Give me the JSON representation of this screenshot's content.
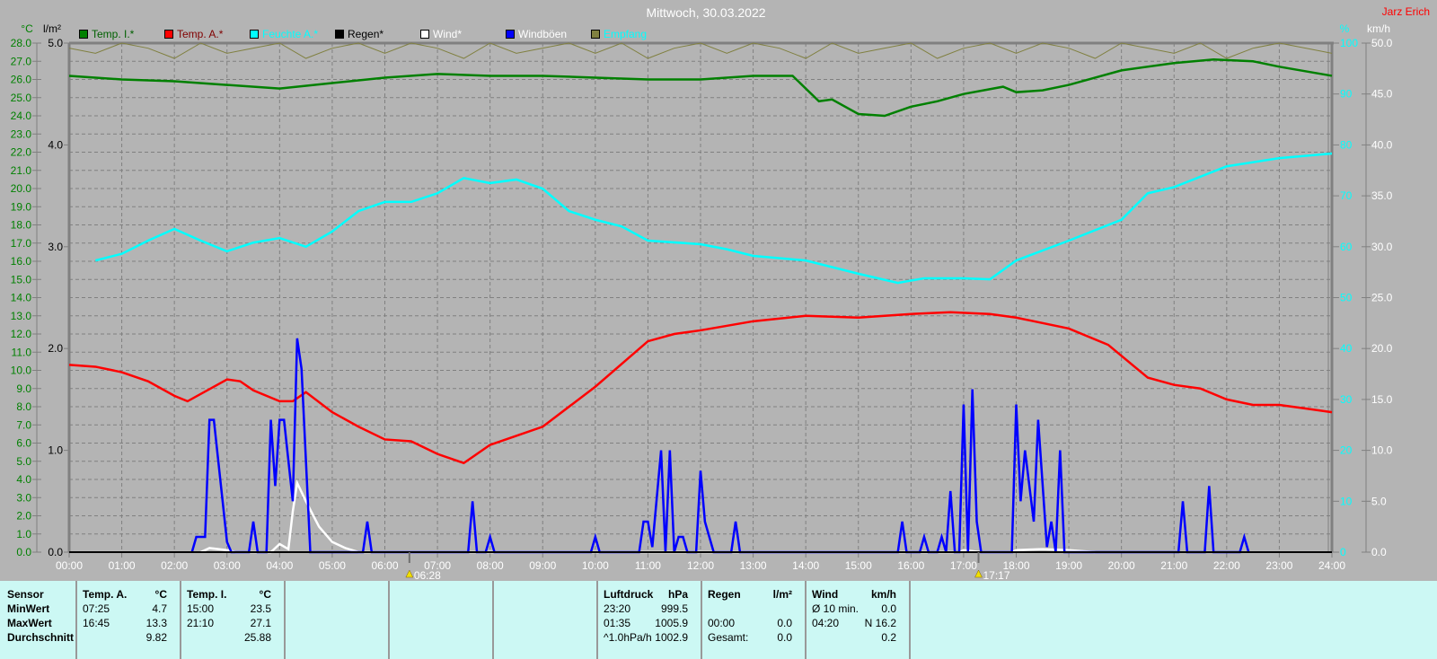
{
  "header": {
    "title": "Mittwoch, 30.03.2022",
    "author": "Jarz Erich"
  },
  "legend": [
    {
      "label": "Temp. I.*",
      "color": "#008000",
      "text_color": "#006000"
    },
    {
      "label": "Temp. A.*",
      "color": "#ff0000",
      "text_color": "#800000"
    },
    {
      "label": "Feuchte A.*",
      "color": "#00ffff",
      "text_color": "#00ffff"
    },
    {
      "label": "Regen*",
      "color": "#000000",
      "text_color": "#000000"
    },
    {
      "label": "Wind*",
      "color": "#ffffff",
      "text_color": "#ffffff"
    },
    {
      "label": "Windböen",
      "color": "#0000ff",
      "text_color": "#ffffff"
    },
    {
      "label": "Empfang",
      "color": "#808040",
      "text_color": "#00ffff"
    }
  ],
  "chart_data": {
    "type": "line",
    "title": "Mittwoch, 30.03.2022",
    "xlabel": "",
    "x_ticks": [
      "00:00",
      "01:00",
      "02:00",
      "03:00",
      "04:00",
      "05:00",
      "06:00",
      "07:00",
      "08:00",
      "09:00",
      "10:00",
      "11:00",
      "12:00",
      "13:00",
      "14:00",
      "15:00",
      "16:00",
      "17:00",
      "18:00",
      "19:00",
      "20:00",
      "21:00",
      "22:00",
      "23:00",
      "24:00"
    ],
    "axes": {
      "temp": {
        "unit": "°C",
        "range": [
          0,
          28
        ],
        "step": 1,
        "color": "#008000"
      },
      "rain": {
        "unit": "l/m²",
        "range": [
          0,
          5
        ],
        "step": 1,
        "color": "#000000"
      },
      "humidity": {
        "unit": "%",
        "range": [
          0,
          100
        ],
        "step": 10,
        "color": "#00ffff"
      },
      "wind": {
        "unit": "km/h",
        "range": [
          0,
          50
        ],
        "step": 5,
        "color": "#ffffff"
      }
    },
    "grid": true,
    "sunrise": "06:28",
    "sunset": "17:17",
    "series": [
      {
        "name": "Temp. I.",
        "axis": "temp",
        "color": "#008000",
        "points": [
          [
            "00:00",
            26.2
          ],
          [
            "01:00",
            26.0
          ],
          [
            "02:00",
            25.9
          ],
          [
            "03:00",
            25.7
          ],
          [
            "04:00",
            25.5
          ],
          [
            "05:00",
            25.8
          ],
          [
            "06:00",
            26.1
          ],
          [
            "07:00",
            26.3
          ],
          [
            "08:00",
            26.2
          ],
          [
            "09:00",
            26.2
          ],
          [
            "10:00",
            26.1
          ],
          [
            "11:00",
            26.0
          ],
          [
            "12:00",
            26.0
          ],
          [
            "13:00",
            26.2
          ],
          [
            "13:45",
            26.2
          ],
          [
            "14:15",
            24.8
          ],
          [
            "14:30",
            24.9
          ],
          [
            "15:00",
            24.1
          ],
          [
            "15:30",
            24.0
          ],
          [
            "16:00",
            24.5
          ],
          [
            "16:30",
            24.8
          ],
          [
            "17:00",
            25.2
          ],
          [
            "17:45",
            25.6
          ],
          [
            "18:00",
            25.3
          ],
          [
            "18:30",
            25.4
          ],
          [
            "19:00",
            25.7
          ],
          [
            "20:00",
            26.5
          ],
          [
            "21:00",
            26.9
          ],
          [
            "21:45",
            27.1
          ],
          [
            "22:30",
            27.0
          ],
          [
            "23:00",
            26.7
          ],
          [
            "24:00",
            26.2
          ]
        ]
      },
      {
        "name": "Temp. A.",
        "axis": "temp",
        "color": "#ff0000",
        "points": [
          [
            "00:00",
            10.3
          ],
          [
            "00:30",
            10.2
          ],
          [
            "01:00",
            9.9
          ],
          [
            "01:30",
            9.4
          ],
          [
            "02:00",
            8.6
          ],
          [
            "02:15",
            8.3
          ],
          [
            "02:30",
            8.7
          ],
          [
            "03:00",
            9.5
          ],
          [
            "03:15",
            9.4
          ],
          [
            "03:30",
            8.9
          ],
          [
            "04:00",
            8.3
          ],
          [
            "04:15",
            8.3
          ],
          [
            "04:30",
            8.8
          ],
          [
            "05:00",
            7.7
          ],
          [
            "05:30",
            6.9
          ],
          [
            "06:00",
            6.2
          ],
          [
            "06:30",
            6.1
          ],
          [
            "07:00",
            5.4
          ],
          [
            "07:30",
            4.9
          ],
          [
            "08:00",
            5.9
          ],
          [
            "09:00",
            6.9
          ],
          [
            "10:00",
            9.1
          ],
          [
            "11:00",
            11.6
          ],
          [
            "11:30",
            12.0
          ],
          [
            "12:00",
            12.2
          ],
          [
            "13:00",
            12.7
          ],
          [
            "14:00",
            13.0
          ],
          [
            "15:00",
            12.9
          ],
          [
            "16:00",
            13.1
          ],
          [
            "16:45",
            13.2
          ],
          [
            "17:30",
            13.1
          ],
          [
            "18:00",
            12.9
          ],
          [
            "19:00",
            12.3
          ],
          [
            "19:45",
            11.4
          ],
          [
            "20:30",
            9.6
          ],
          [
            "21:00",
            9.2
          ],
          [
            "21:30",
            9.0
          ],
          [
            "22:00",
            8.4
          ],
          [
            "22:30",
            8.1
          ],
          [
            "23:00",
            8.1
          ],
          [
            "23:30",
            7.9
          ],
          [
            "24:00",
            7.7
          ]
        ]
      },
      {
        "name": "Feuchte A.",
        "axis": "humidity",
        "color": "#00ffff",
        "points": [
          [
            "00:30",
            57.3
          ],
          [
            "01:00",
            58.6
          ],
          [
            "01:30",
            61.2
          ],
          [
            "02:00",
            63.5
          ],
          [
            "02:30",
            61.2
          ],
          [
            "03:00",
            59.1
          ],
          [
            "03:30",
            60.8
          ],
          [
            "04:00",
            61.7
          ],
          [
            "04:30",
            60.0
          ],
          [
            "05:00",
            63.0
          ],
          [
            "05:30",
            67.0
          ],
          [
            "06:00",
            68.8
          ],
          [
            "06:30",
            68.8
          ],
          [
            "07:00",
            70.5
          ],
          [
            "07:30",
            73.5
          ],
          [
            "08:00",
            72.5
          ],
          [
            "08:30",
            73.2
          ],
          [
            "09:00",
            71.4
          ],
          [
            "09:30",
            67.0
          ],
          [
            "10:00",
            65.3
          ],
          [
            "10:30",
            64.0
          ],
          [
            "11:00",
            61.2
          ],
          [
            "12:00",
            60.5
          ],
          [
            "12:30",
            59.5
          ],
          [
            "13:00",
            58.2
          ],
          [
            "14:00",
            57.3
          ],
          [
            "15:00",
            54.7
          ],
          [
            "15:45",
            52.9
          ],
          [
            "16:15",
            53.8
          ],
          [
            "17:00",
            53.8
          ],
          [
            "17:30",
            53.6
          ],
          [
            "18:00",
            57.3
          ],
          [
            "19:00",
            61.2
          ],
          [
            "20:00",
            65.3
          ],
          [
            "20:30",
            70.5
          ],
          [
            "21:00",
            71.7
          ],
          [
            "22:00",
            75.8
          ],
          [
            "23:00",
            77.4
          ],
          [
            "24:00",
            78.3
          ]
        ]
      },
      {
        "name": "Wind",
        "axis": "wind",
        "color": "#ffffff",
        "points": [
          [
            "02:30",
            0
          ],
          [
            "02:40",
            0.4
          ],
          [
            "03:00",
            0.2
          ],
          [
            "03:10",
            0
          ],
          [
            "03:50",
            0
          ],
          [
            "04:00",
            0.8
          ],
          [
            "04:10",
            0.3
          ],
          [
            "04:15",
            4
          ],
          [
            "04:20",
            6.8
          ],
          [
            "04:30",
            5
          ],
          [
            "04:45",
            2.5
          ],
          [
            "05:00",
            1
          ],
          [
            "05:15",
            0.4
          ],
          [
            "05:30",
            0
          ],
          [
            "16:55",
            0
          ],
          [
            "17:00",
            0.2
          ],
          [
            "17:20",
            0
          ],
          [
            "17:55",
            0
          ],
          [
            "18:00",
            0.2
          ],
          [
            "18:30",
            0.3
          ],
          [
            "19:00",
            0.2
          ],
          [
            "19:30",
            0
          ]
        ]
      },
      {
        "name": "Windböen",
        "axis": "wind",
        "color": "#0000ff",
        "points": [
          [
            "02:20",
            0
          ],
          [
            "02:25",
            1.5
          ],
          [
            "02:35",
            1.5
          ],
          [
            "02:40",
            13
          ],
          [
            "02:45",
            13
          ],
          [
            "02:55",
            5
          ],
          [
            "03:00",
            1
          ],
          [
            "03:05",
            0
          ],
          [
            "03:25",
            0
          ],
          [
            "03:30",
            3
          ],
          [
            "03:35",
            0
          ],
          [
            "03:45",
            0
          ],
          [
            "03:50",
            13
          ],
          [
            "03:55",
            6.5
          ],
          [
            "04:00",
            13
          ],
          [
            "04:05",
            13
          ],
          [
            "04:15",
            5
          ],
          [
            "04:20",
            21
          ],
          [
            "04:25",
            18
          ],
          [
            "04:35",
            0
          ],
          [
            "05:35",
            0
          ],
          [
            "05:40",
            3
          ],
          [
            "05:45",
            0
          ],
          [
            "07:35",
            0
          ],
          [
            "07:40",
            5
          ],
          [
            "07:45",
            0
          ],
          [
            "07:55",
            0
          ],
          [
            "08:00",
            1.5
          ],
          [
            "08:05",
            0
          ],
          [
            "09:55",
            0
          ],
          [
            "10:00",
            1.5
          ],
          [
            "10:05",
            0
          ],
          [
            "10:50",
            0
          ],
          [
            "10:55",
            3
          ],
          [
            "11:00",
            3
          ],
          [
            "11:05",
            0.5
          ],
          [
            "11:15",
            10
          ],
          [
            "11:20",
            0
          ],
          [
            "11:25",
            10
          ],
          [
            "11:30",
            0
          ],
          [
            "11:35",
            1.5
          ],
          [
            "11:40",
            1.5
          ],
          [
            "11:45",
            0
          ],
          [
            "11:55",
            0
          ],
          [
            "12:00",
            8
          ],
          [
            "12:05",
            3
          ],
          [
            "12:15",
            0
          ],
          [
            "12:35",
            0
          ],
          [
            "12:40",
            3
          ],
          [
            "12:45",
            0
          ],
          [
            "15:45",
            0
          ],
          [
            "15:50",
            3
          ],
          [
            "15:55",
            0
          ],
          [
            "16:10",
            0
          ],
          [
            "16:15",
            1.5
          ],
          [
            "16:20",
            0
          ],
          [
            "16:30",
            0
          ],
          [
            "16:35",
            1.5
          ],
          [
            "16:40",
            0
          ],
          [
            "16:45",
            6
          ],
          [
            "16:50",
            0
          ],
          [
            "16:55",
            0
          ],
          [
            "17:00",
            14.5
          ],
          [
            "17:05",
            0
          ],
          [
            "17:10",
            16
          ],
          [
            "17:15",
            3
          ],
          [
            "17:20",
            0
          ],
          [
            "17:55",
            0
          ],
          [
            "18:00",
            14.5
          ],
          [
            "18:05",
            5
          ],
          [
            "18:10",
            10
          ],
          [
            "18:20",
            3
          ],
          [
            "18:25",
            13
          ],
          [
            "18:35",
            0.5
          ],
          [
            "18:40",
            3
          ],
          [
            "18:45",
            0
          ],
          [
            "18:50",
            10
          ],
          [
            "18:55",
            0
          ],
          [
            "21:05",
            0
          ],
          [
            "21:10",
            5
          ],
          [
            "21:15",
            0
          ],
          [
            "21:35",
            0
          ],
          [
            "21:40",
            6.5
          ],
          [
            "21:45",
            0
          ],
          [
            "22:15",
            0
          ],
          [
            "22:20",
            1.5
          ],
          [
            "22:25",
            0
          ]
        ]
      },
      {
        "name": "Empfang",
        "axis": "humidity",
        "color": "#808040",
        "step_minutes": 30,
        "values": [
          99,
          98,
          100,
          99,
          97,
          100,
          98,
          99,
          100,
          97,
          99,
          100,
          98,
          100,
          99,
          97,
          100,
          98,
          99,
          100,
          98,
          100,
          97,
          99,
          100,
          98,
          100,
          99,
          97,
          100,
          98,
          99,
          100,
          97,
          99,
          100,
          98,
          100,
          99,
          97,
          100,
          99,
          98,
          100,
          97,
          99,
          100,
          99,
          98
        ]
      },
      {
        "name": "Regen",
        "axis": "rain",
        "color": "#000000",
        "points": [
          [
            "00:00",
            0
          ],
          [
            "24:00",
            0
          ]
        ]
      }
    ]
  },
  "table": {
    "columns": [
      {
        "header": [
          "Sensor",
          ""
        ],
        "rows": [
          [
            "MinWert",
            ""
          ],
          [
            "MaxWert",
            ""
          ],
          [
            "Durchschnitt",
            ""
          ]
        ],
        "bold_rows": true
      },
      {
        "header": [
          "Temp. A.",
          "°C"
        ],
        "rows": [
          [
            "07:25",
            "4.7"
          ],
          [
            "16:45",
            "13.3"
          ],
          [
            "",
            "9.82"
          ]
        ]
      },
      {
        "header": [
          "Temp. I.",
          "°C"
        ],
        "rows": [
          [
            "15:00",
            "23.5"
          ],
          [
            "21:10",
            "27.1"
          ],
          [
            "",
            "25.88"
          ]
        ]
      },
      {
        "header": [
          "",
          ""
        ],
        "rows": []
      },
      {
        "header": [
          "",
          ""
        ],
        "rows": []
      },
      {
        "header": [
          "",
          ""
        ],
        "rows": []
      },
      {
        "header": [
          "Luftdruck",
          "hPa"
        ],
        "rows": [
          [
            "23:20",
            "999.5"
          ],
          [
            "01:35",
            "1005.9"
          ],
          [
            "^1.0hPa/h",
            "1002.9"
          ]
        ]
      },
      {
        "header": [
          "Regen",
          "l/m²"
        ],
        "rows": [
          [
            "",
            ""
          ],
          [
            "00:00",
            "0.0"
          ],
          [
            "Gesamt:",
            "0.0"
          ]
        ]
      },
      {
        "header": [
          "Wind",
          "km/h"
        ],
        "rows": [
          [
            "Ø 10 min.",
            "0.0"
          ],
          [
            "04:20",
            "N 16.2"
          ],
          [
            "",
            "0.2"
          ]
        ]
      }
    ]
  }
}
